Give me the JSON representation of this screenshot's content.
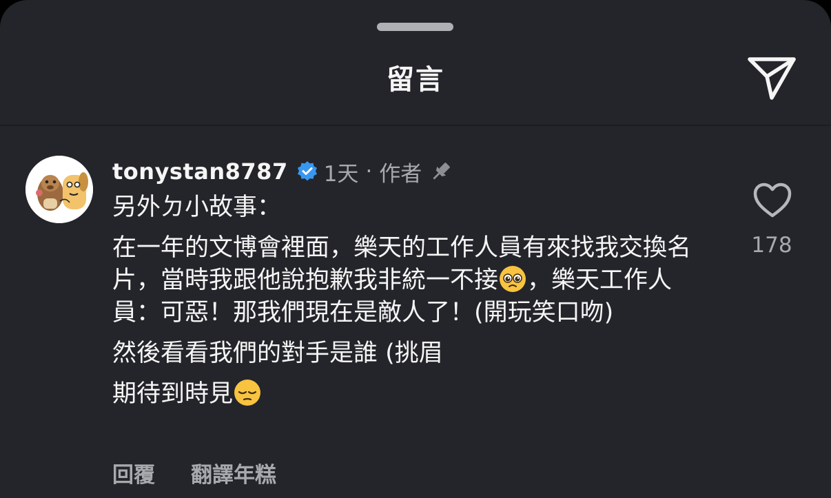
{
  "header": {
    "title": "留言"
  },
  "comment": {
    "username": "tonystan8787",
    "time": "1天",
    "separator": "·",
    "role": "作者",
    "paragraph1": "另外ㄉ小故事：",
    "paragraph2_part1": "在一年的文博會裡面，樂天的工作人員有來找我交換名片，當時我跟他說抱歉我非統一不接",
    "paragraph2_part2": "，樂天工作人員：可惡！那我們現在是敵人了！(開玩笑口吻)",
    "paragraph3": "然後看看我們的對手是誰 (挑眉",
    "paragraph4": "期待到時見",
    "emoji1": "pleading-face-emoji",
    "emoji2": "pensive-face-emoji",
    "reply_label": "回覆",
    "translate_label": "翻譯年糕",
    "like_count": "178"
  },
  "icons": {
    "share": "paper-plane-icon",
    "verified": "verified-badge-icon",
    "pin": "pin-icon",
    "like": "heart-icon"
  },
  "colors": {
    "background": "#24252a",
    "text_primary": "#f5f5f5",
    "text_secondary": "#a8a9ad",
    "verified": "#3897f0"
  }
}
